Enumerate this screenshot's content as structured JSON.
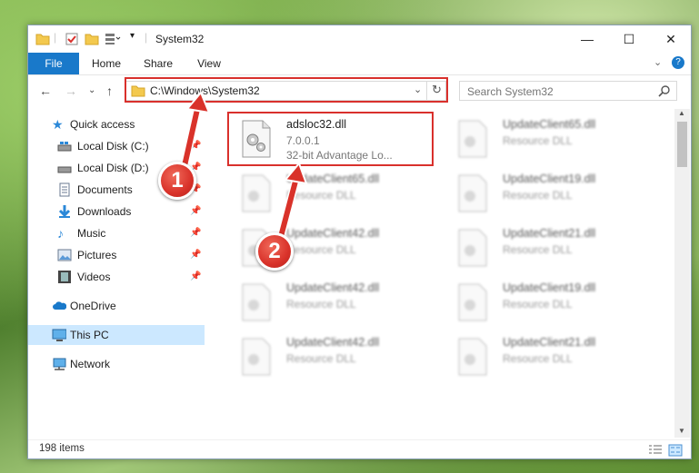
{
  "window": {
    "title": "System32"
  },
  "ribbon": {
    "tabs": [
      "File",
      "Home",
      "Share",
      "View"
    ]
  },
  "address": {
    "path": "C:\\Windows\\System32"
  },
  "search": {
    "placeholder": "Search System32"
  },
  "sidebar": {
    "items": [
      {
        "label": "Quick access",
        "icon": "star-icon",
        "pinned": false
      },
      {
        "label": "Local Disk (C:)",
        "icon": "drive-icon",
        "pinned": true
      },
      {
        "label": "Local Disk (D:)",
        "icon": "drive-icon",
        "pinned": true
      },
      {
        "label": "Documents",
        "icon": "documents-icon",
        "pinned": true
      },
      {
        "label": "Downloads",
        "icon": "downloads-icon",
        "pinned": true
      },
      {
        "label": "Music",
        "icon": "music-icon",
        "pinned": true
      },
      {
        "label": "Pictures",
        "icon": "pictures-icon",
        "pinned": true
      },
      {
        "label": "Videos",
        "icon": "videos-icon",
        "pinned": true
      },
      {
        "label": "OneDrive",
        "icon": "cloud-icon",
        "pinned": false
      },
      {
        "label": "This PC",
        "icon": "computer-icon",
        "pinned": false,
        "selected": true
      },
      {
        "label": "Network",
        "icon": "network-icon",
        "pinned": false
      }
    ]
  },
  "files": [
    {
      "name": "adsloc32.dll",
      "line2": "7.0.0.1",
      "line3": "32-bit Advantage Lo...",
      "highlighted": true
    },
    {
      "name": "UpdateClient65.dll",
      "line2": "Resource DLL"
    },
    {
      "name": "UpdateClient65.dll",
      "line2": "Resource DLL"
    },
    {
      "name": "UpdateClient19.dll",
      "line2": "Resource DLL"
    },
    {
      "name": "UpdateClient42.dll",
      "line2": "Resource DLL"
    },
    {
      "name": "UpdateClient21.dll",
      "line2": "Resource DLL"
    },
    {
      "name": "UpdateClient42.dll",
      "line2": "Resource DLL"
    },
    {
      "name": "UpdateClient19.dll",
      "line2": "Resource DLL"
    },
    {
      "name": "UpdateClient42.dll",
      "line2": "Resource DLL"
    },
    {
      "name": "UpdateClient21.dll",
      "line2": "Resource DLL"
    }
  ],
  "status": {
    "item_count": "198 items"
  },
  "annotations": {
    "step1": "1",
    "step2": "2"
  },
  "colors": {
    "accent": "#1979ca",
    "highlight": "#d9302c",
    "selected_bg": "#cce8ff"
  }
}
